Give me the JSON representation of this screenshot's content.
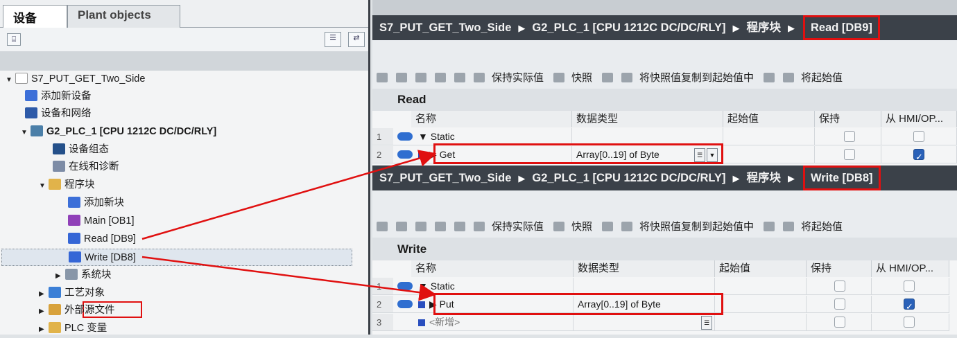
{
  "left_pane": {
    "tabs": [
      "设备",
      "Plant objects"
    ],
    "tree": [
      {
        "label": "S7_PUT_GET_Two_Side",
        "indent": 0,
        "arrow": "▼",
        "icon": "project-icon"
      },
      {
        "label": "添加新设备",
        "indent": 1,
        "arrow": "",
        "icon": "add-device-icon"
      },
      {
        "label": "设备和网络",
        "indent": 1,
        "arrow": "",
        "icon": "network-icon"
      },
      {
        "label": "G2_PLC_1 [CPU 1212C DC/DC/RLY]",
        "indent": 1,
        "arrow": "▼",
        "icon": "plc-icon"
      },
      {
        "label": "设备组态",
        "indent": 2,
        "arrow": "",
        "icon": "device-config-icon"
      },
      {
        "label": "在线和诊断",
        "indent": 2,
        "arrow": "",
        "icon": "diagnostics-icon"
      },
      {
        "label": "程序块",
        "indent": 2,
        "arrow": "▼",
        "icon": "folder-icon"
      },
      {
        "label": "添加新块",
        "indent": 3,
        "arrow": "",
        "icon": "add-block-icon"
      },
      {
        "label": "Main [OB1]",
        "indent": 3,
        "arrow": "",
        "icon": "ob-icon"
      },
      {
        "label": "Read [DB9]",
        "indent": 3,
        "arrow": "",
        "icon": "db-icon"
      },
      {
        "label": "Write [DB8]",
        "indent": 3,
        "arrow": "",
        "icon": "db-icon"
      },
      {
        "label": "系统块",
        "indent": 3,
        "arrow": "▶",
        "icon": "system-block-icon"
      },
      {
        "label": "工艺对象",
        "indent": 2,
        "arrow": "▶",
        "icon": "tech-object-icon"
      },
      {
        "label": "外部源文件",
        "indent": 2,
        "arrow": "▶",
        "icon": "external-source-icon"
      },
      {
        "label": "PLC 变量",
        "indent": 2,
        "arrow": "▶",
        "icon": "plc-tags-icon"
      }
    ]
  },
  "breadcrumbs": {
    "project": "S7_PUT_GET_Two_Side",
    "plc": "G2_PLC_1 [CPU 1212C DC/DC/RLY]",
    "folder": "程序块",
    "read_db": "Read [DB9]",
    "write_db": "Write [DB8]"
  },
  "toolbar": {
    "keep_actual": "保持实际值",
    "snapshot": "快照",
    "copy_snapshot": "将快照值复制到起始值中",
    "start_to": "将起始值"
  },
  "columns": {
    "name": "名称",
    "datatype": "数据类型",
    "start": "起始值",
    "retain": "保持",
    "hmi_read": "从 HMI/OP...",
    "hmi_write": "从 HMI/OP..."
  },
  "read_block": {
    "title": "Read",
    "rows": [
      {
        "num": "1",
        "name": "Static",
        "type": "",
        "retain": false,
        "hmi": false
      },
      {
        "num": "2",
        "name": "Get",
        "type": "Array[0..19] of Byte",
        "retain": false,
        "hmi": true
      }
    ]
  },
  "write_block": {
    "title": "Write",
    "rows": [
      {
        "num": "1",
        "name": "Static",
        "type": "",
        "retain": false,
        "hmi": false
      },
      {
        "num": "2",
        "name": "Put",
        "type": "Array[0..19] of Byte",
        "retain": false,
        "hmi": true
      },
      {
        "num": "3",
        "name": "<新增>",
        "type": "",
        "retain": false,
        "hmi": false
      }
    ]
  },
  "colors": {
    "highlight_red": "#e01010",
    "breadcrumb_bg": "#3b4149"
  }
}
